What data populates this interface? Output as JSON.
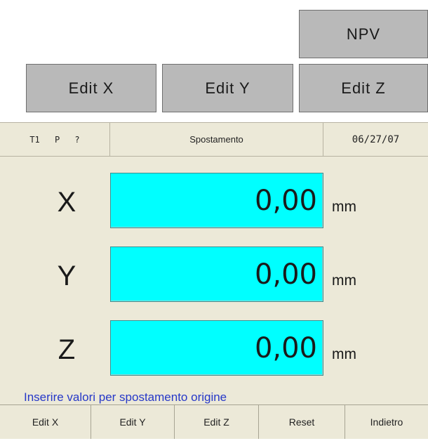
{
  "softkeys": {
    "npv": "NPV",
    "edit_x": "Edit X",
    "edit_y": "Edit Y",
    "edit_z": "Edit Z"
  },
  "header": {
    "tool_pos": "T1 P ?",
    "title": "Spostamento",
    "date": "06/27/07"
  },
  "axes": [
    {
      "label": "X",
      "value": "0,00",
      "unit": "mm"
    },
    {
      "label": "Y",
      "value": "0,00",
      "unit": "mm"
    },
    {
      "label": "Z",
      "value": "0,00",
      "unit": "mm"
    }
  ],
  "status_message": "Inserire valori per spostamento origine",
  "bottom_bar": {
    "edit_x": "Edit X",
    "edit_y": "Edit Y",
    "edit_z": "Edit Z",
    "reset": "Reset",
    "back": "Indietro"
  },
  "colors": {
    "softkey_bg": "#b9b9b9",
    "panel_bg": "#ece9d8",
    "value_bg": "#00ffff",
    "status_text": "#2638c8"
  }
}
